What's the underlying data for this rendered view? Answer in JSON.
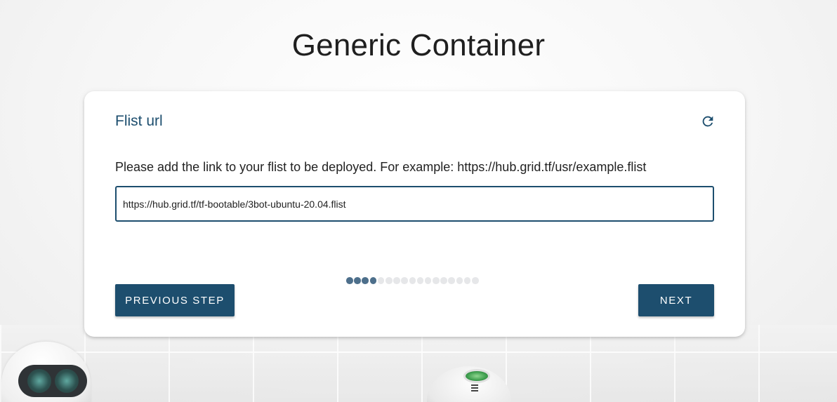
{
  "page": {
    "title": "Generic Container"
  },
  "step": {
    "title": "Flist url",
    "description": "Please add the link to your flist to be deployed. For example: https://hub.grid.tf/usr/example.flist",
    "input_value": "https://hub.grid.tf/tf-bootable/3bot-ubuntu-20.04.flist",
    "refresh_icon": "refresh-icon"
  },
  "progress": {
    "current_step": 4,
    "total_steps": 17
  },
  "buttons": {
    "previous_label": "PREVIOUS STEP",
    "next_label": "NEXT"
  },
  "colors": {
    "accent": "#1d4e6e",
    "dot_active": "#4d6f8b",
    "dot_inactive": "#e6e7e9"
  }
}
